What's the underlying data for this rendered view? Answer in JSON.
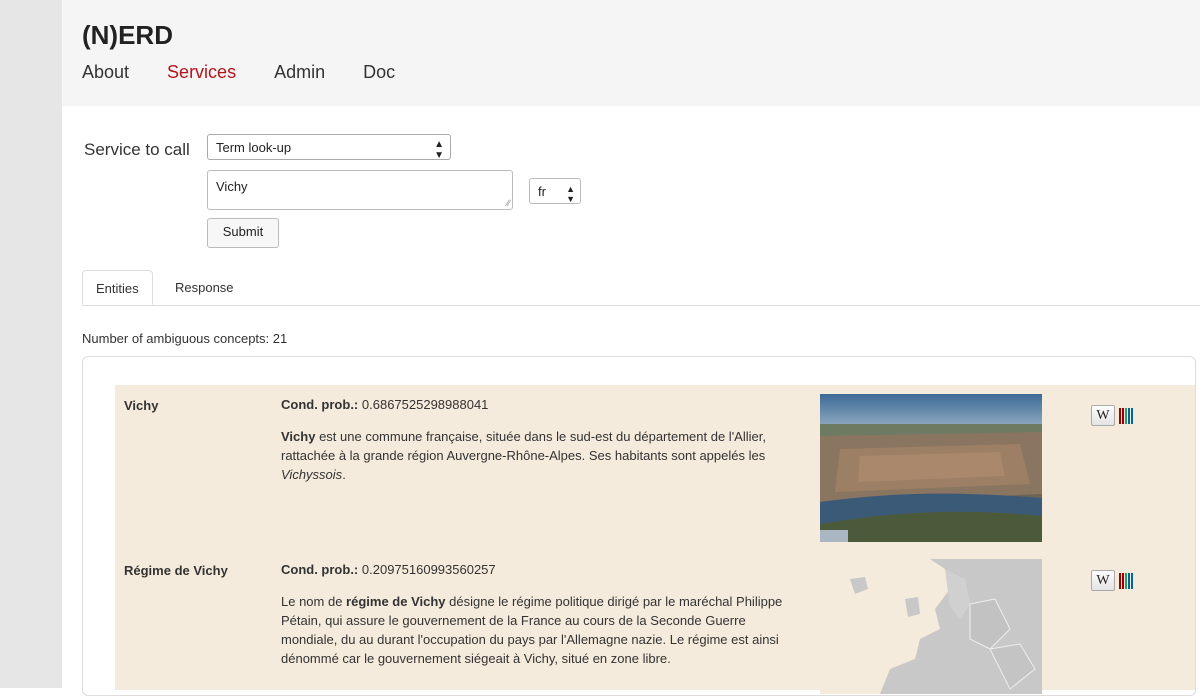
{
  "header": {
    "brand": "(N)ERD",
    "nav": [
      {
        "label": "About",
        "active": false
      },
      {
        "label": "Services",
        "active": true
      },
      {
        "label": "Admin",
        "active": false
      },
      {
        "label": "Doc",
        "active": false
      }
    ]
  },
  "form": {
    "service_label": "Service to call",
    "service_value": "Term look-up",
    "query_value": "Vichy",
    "lang_value": "fr",
    "submit_label": "Submit"
  },
  "tabs": {
    "entities": "Entities",
    "response": "Response"
  },
  "summary": {
    "text": "Number of ambiguous concepts: 21"
  },
  "entities": [
    {
      "name": "Vichy",
      "cond_label": "Cond. prob.:",
      "cond_value": "0.6867525298988041",
      "desc_bold": "Vichy",
      "desc_text": " est une commune française, située dans le sud-est du département de l'Allier, rattachée à la grande région Auvergne-Rhône-Alpes. Ses habitants sont appelés les ",
      "desc_italic": "Vichyssois",
      "desc_end": ".",
      "image": "aerial-city-photo"
    },
    {
      "name": "Régime de Vichy",
      "cond_label": "Cond. prob.:",
      "cond_value": "0.20975160993560257",
      "desc_pre": "Le nom de ",
      "desc_bold": "régime de Vichy",
      "desc_text": " désigne le régime politique dirigé par le maréchal Philippe Pétain, qui assure le gouvernement de la France au cours de la Seconde Guerre mondiale, du au durant l'occupation du pays par l'Allemagne nazie. Le régime est ainsi dénommé car le gouvernement siégeait à Vichy, situé en zone libre.",
      "image": "europe-map"
    }
  ],
  "icons": {
    "wikipedia": "W",
    "wikidata_colors": [
      "#990000",
      "#339966",
      "#006699"
    ]
  }
}
